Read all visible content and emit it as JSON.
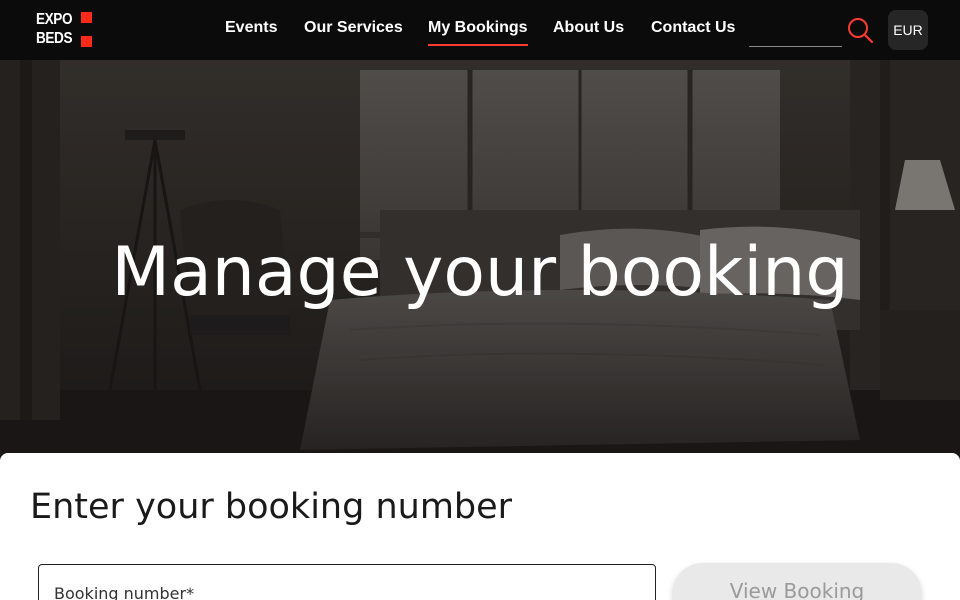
{
  "brand": {
    "logo_line1": "EXPO",
    "logo_line2": "BEDS",
    "accent_color": "#ff2a1a"
  },
  "nav": {
    "items": [
      {
        "label": "Events",
        "active": false
      },
      {
        "label": "Our Services",
        "active": false
      },
      {
        "label": "My Bookings",
        "active": true
      },
      {
        "label": "About Us",
        "active": false
      },
      {
        "label": "Contact Us",
        "active": false
      }
    ],
    "search_value": "",
    "search_icon": "search-icon",
    "currency": "EUR"
  },
  "hero": {
    "title": "Manage your booking",
    "image": "dark hotel bedroom"
  },
  "booking": {
    "heading": "Enter your booking number",
    "input_label": "Booking number*",
    "button_label": "View Booking"
  }
}
